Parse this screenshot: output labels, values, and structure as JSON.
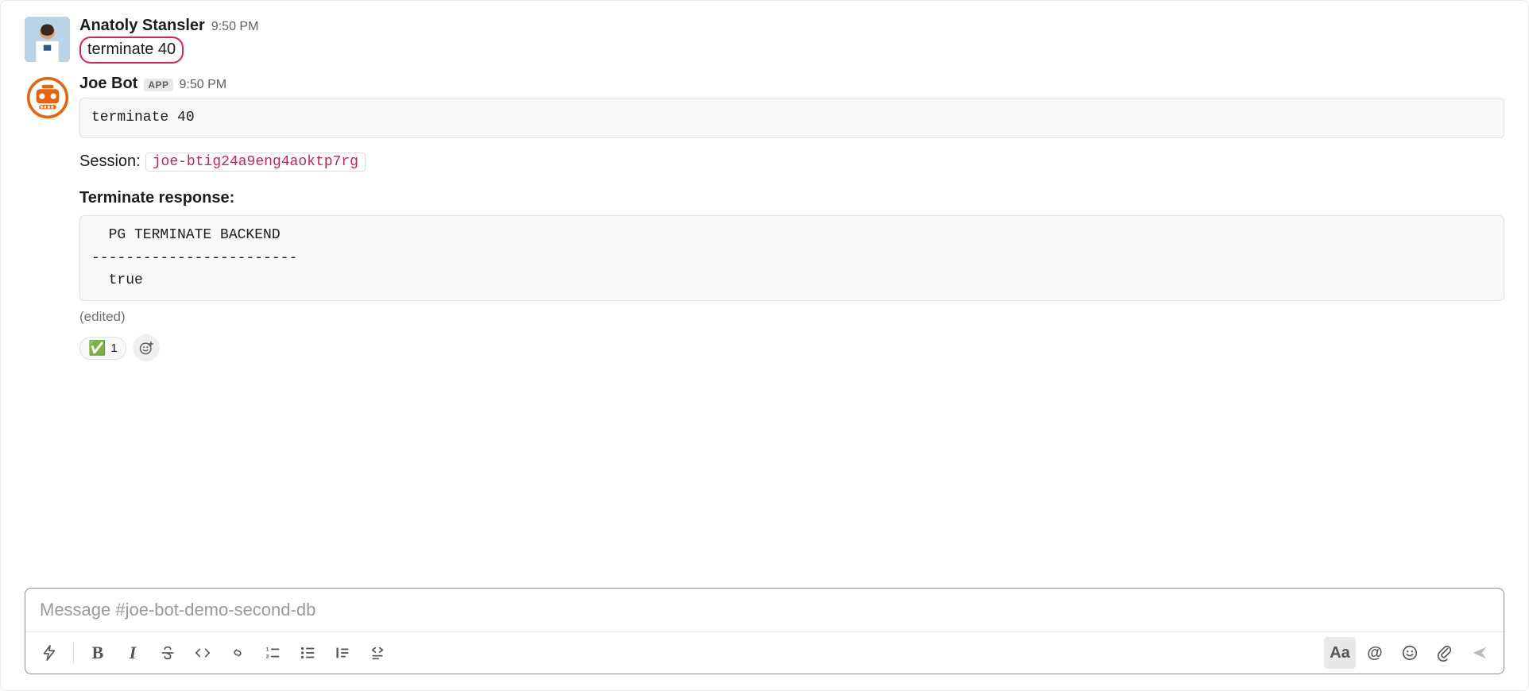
{
  "messages": [
    {
      "author": "Anatoly Stansler",
      "time": "9:50 PM",
      "text": "terminate 40",
      "highlighted": true
    },
    {
      "author": "Joe Bot",
      "badge": "APP",
      "time": "9:50 PM",
      "quote_block": "terminate 40",
      "session_label": "Session:",
      "session_id": "joe-btig24a9eng4aoktp7rg",
      "response_title": "Terminate response:",
      "response_body": "  PG TERMINATE BACKEND  \n------------------------\n  true",
      "edited": "(edited)",
      "reactions": [
        {
          "emoji": "✅",
          "count": "1"
        }
      ]
    }
  ],
  "composer": {
    "placeholder": "Message #joe-bot-demo-second-db"
  },
  "toolbar": {
    "bold": "B",
    "italic": "I",
    "format_text": "Aa",
    "mention": "@"
  }
}
